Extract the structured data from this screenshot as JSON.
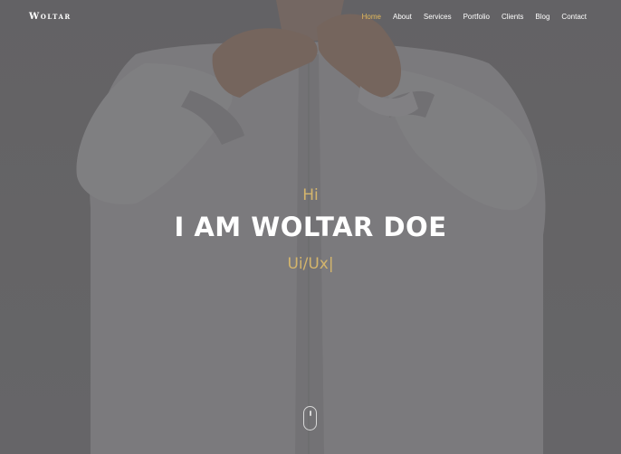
{
  "brand": {
    "logo_text": "Woltar"
  },
  "nav": {
    "items": [
      {
        "label": "Home",
        "active": true
      },
      {
        "label": "About",
        "active": false
      },
      {
        "label": "Services",
        "active": false
      },
      {
        "label": "Portfolio",
        "active": false
      },
      {
        "label": "Clients",
        "active": false
      },
      {
        "label": "Blog",
        "active": false
      },
      {
        "label": "Contact",
        "active": false
      }
    ]
  },
  "hero": {
    "greeting": "Hi",
    "name": "I AM WOLTAR DOE",
    "role": "Ui/Ux|",
    "scroll_icon": "mouse-scroll-icon"
  },
  "colors": {
    "accent": "#e4b95b",
    "accent_text": "#d4b56c",
    "overlay": "#6b6a6c",
    "text": "#ffffff"
  }
}
